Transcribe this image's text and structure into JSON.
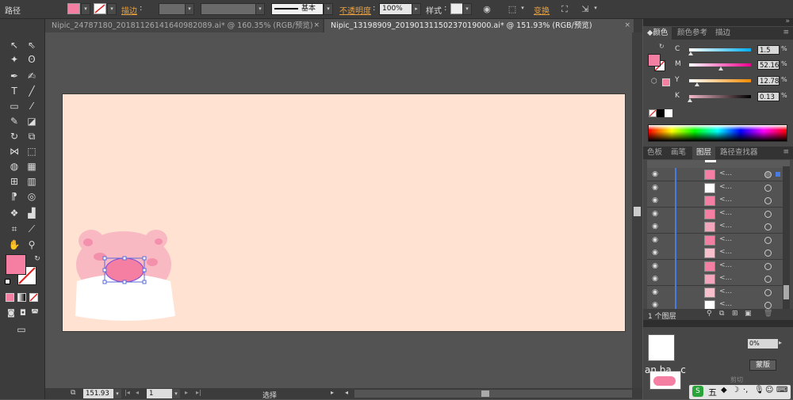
{
  "control_bar": {
    "path_label": "路径",
    "fill_color": "#f47fa2",
    "stroke_label": "描边",
    "stroke_colon": ":",
    "stroke_profile_label": "基本",
    "opacity_label": "不透明度",
    "opacity_colon": ":",
    "opacity_value": "100%",
    "style_label": "样式",
    "style_colon": ":",
    "transform_label": "变换"
  },
  "doc_tabs": [
    {
      "title": "Nipic_24787180_20181126141640982089.ai* @ 160.35% (RGB/预览)",
      "active": false
    },
    {
      "title": "Nipic_13198909_20190131150237019000.ai* @ 151.93% (RGB/预览)",
      "active": true
    }
  ],
  "tab_close_glyph": "×",
  "tools_panel": {
    "fill_color": "#f47fa2"
  },
  "color_panel": {
    "tabs": [
      "颜色",
      "颜色参考",
      "描边"
    ],
    "active_tab": "颜色",
    "fill_color": "#f47fa2",
    "channels": [
      {
        "label": "C",
        "value": "1.5",
        "level": 0.015,
        "gradient": "linear-gradient(90deg,#fff,#00aeef)"
      },
      {
        "label": "M",
        "value": "52.16",
        "level": 0.5216,
        "gradient": "linear-gradient(90deg,#fff,#ec008c)"
      },
      {
        "label": "Y",
        "value": "12.78",
        "level": 0.1278,
        "gradient": "linear-gradient(90deg,#fff,#fff200)"
      },
      {
        "label": "K",
        "value": "0.13",
        "level": 0.0013,
        "gradient": "linear-gradient(90deg,#fff,#000)"
      }
    ],
    "pct": "%"
  },
  "layers_panel": {
    "tabs": [
      "色板",
      "画笔",
      "图层",
      "路径查找器"
    ],
    "active_tab": "图层",
    "rows": [
      {
        "name": "<...",
        "thumb": "#f47fa2",
        "selected": true
      },
      {
        "name": "<...",
        "thumb": "#ffffff",
        "selected": false
      },
      {
        "name": "<...",
        "thumb": "#f47fa2",
        "selected": false
      },
      {
        "name": "<...",
        "thumb": "#f47fa2",
        "selected": false
      },
      {
        "name": "<...",
        "thumb": "#f3a6bb",
        "selected": false
      },
      {
        "name": "<...",
        "thumb": "#f47fa2",
        "selected": false
      },
      {
        "name": "<...",
        "thumb": "#f8c0cd",
        "selected": false
      },
      {
        "name": "<...",
        "thumb": "#f47fa2",
        "selected": false
      },
      {
        "name": "<...",
        "thumb": "#f3a6bb",
        "selected": false
      },
      {
        "name": "<...",
        "thumb": "#f8c0cd",
        "selected": false
      },
      {
        "name": "<...",
        "thumb": "#ffffff",
        "selected": false
      },
      {
        "name": "<...",
        "thumb": "#ffffff",
        "selected": false
      }
    ],
    "footer_count": "1 个图层"
  },
  "lower_panel": {
    "percent_value": "0%",
    "button_label": "蒙版",
    "caption_text": "剪切"
  },
  "status_bar": {
    "zoom_value": "151.93",
    "page_value": "1",
    "mode_label": "选择"
  },
  "watermark_text": "an.ba...c",
  "ime_bar": {
    "lang_label": "五"
  }
}
